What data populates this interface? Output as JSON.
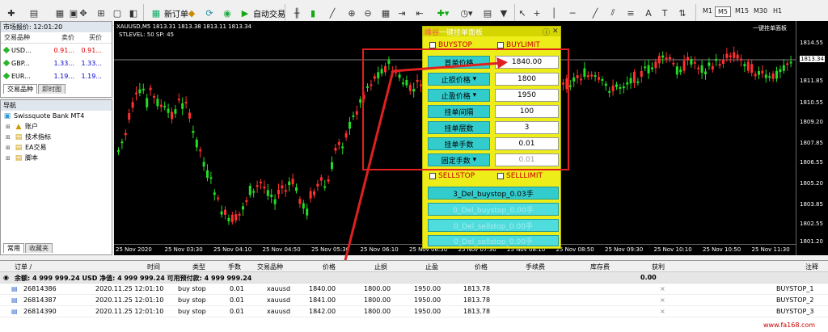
{
  "toolbar": {
    "new_order": "新订单",
    "auto_trading": "自动交易",
    "timeframes": [
      "M1",
      "M5",
      "M15",
      "M30",
      "H1"
    ],
    "active_timeframe": "M5"
  },
  "market_watch": {
    "title": "市场报价: 12:01:20",
    "columns": [
      "交易品种",
      "卖价",
      "买价"
    ],
    "rows": [
      {
        "symbol": "USD...",
        "bid": "0.91...",
        "ask": "0.91..."
      },
      {
        "symbol": "GBP...",
        "bid": "1.33...",
        "ask": "1.33..."
      },
      {
        "symbol": "EUR...",
        "bid": "1.19...",
        "ask": "1.19..."
      }
    ],
    "tabs": [
      "交易品种",
      "即时图"
    ]
  },
  "navigator": {
    "title": "导航",
    "root": "Swissquote Bank MT4",
    "items": [
      "账户",
      "技术指标",
      "EA交易",
      "脚本"
    ],
    "tabs": [
      "常用",
      "收藏夹"
    ]
  },
  "chart": {
    "info": "XAUUSD,M5  1813.31 1813.38 1813.11 1813.34",
    "info2": "STLEVEL:  50      SP:  45",
    "ea_label": "一键挂单面板",
    "price_labels": [
      "1814.55",
      "1813.34",
      "1811.85",
      "1810.55",
      "1809.20",
      "1807.85",
      "1806.55",
      "1805.20",
      "1803.85",
      "1802.55",
      "1801.20"
    ],
    "time_labels": [
      "25 Nov 2020",
      "25 Nov 03:30",
      "25 Nov 04:10",
      "25 Nov 04:50",
      "25 Nov 05:30",
      "25 Nov 06:10",
      "25 Nov 06:50",
      "25 Nov 07:30",
      "25 Nov 08:10",
      "25 Nov 08:50",
      "25 Nov 09:30",
      "25 Nov 10:10",
      "25 Nov 10:50",
      "25 Nov 11:30"
    ],
    "colors": {
      "bull": "#ff3030",
      "bear": "#22dd22",
      "bg": "#000000"
    }
  },
  "panel": {
    "title": "一键挂单面板",
    "logo": "峰谷",
    "buystop": "BUYSTOP",
    "buylimit": "BUYLIMIT",
    "sellstop": "SELLSTOP",
    "selllimit": "SELLLIMIT",
    "fields": [
      {
        "label": "首单价格",
        "value": "1840.00",
        "dropdown": false
      },
      {
        "label": "止损价格",
        "value": "1800",
        "dropdown": true
      },
      {
        "label": "止盈价格",
        "value": "1950",
        "dropdown": true
      },
      {
        "label": "挂单间隔",
        "value": "100",
        "dropdown": false
      },
      {
        "label": "挂单层数",
        "value": "3",
        "dropdown": false
      },
      {
        "label": "挂单手数",
        "value": "0.01",
        "dropdown": false
      },
      {
        "label": "固定手数",
        "value": "0.01",
        "dropdown": true
      }
    ],
    "delete_button": "3_Del_buystop_0.03手",
    "faded_buttons": [
      "0_Del_buystop_0.00手",
      "0_Del_sellstop_0.00手",
      "0_Del_sellstop_0.00手"
    ]
  },
  "orders": {
    "columns": [
      "订单 /",
      "时间",
      "类型",
      "手数",
      "交易品种",
      "价格",
      "止损",
      "止盈",
      "价格",
      "手续费",
      "库存费",
      "获利",
      "注释"
    ],
    "summary": "余额: 4 999 999.24 USD  净值: 4 999 999.24  可用预付款: 4 999 999.24",
    "summary_profit": "0.00",
    "rows": [
      {
        "id": "26814386",
        "time": "2020.11.25 12:01:10",
        "type": "buy stop",
        "lots": "0.01",
        "symbol": "xauusd",
        "price": "1840.00",
        "sl": "1800.00",
        "tp": "1950.00",
        "cur": "1813.78",
        "comment": "BUYSTOP_1"
      },
      {
        "id": "26814387",
        "time": "2020.11.25 12:01:10",
        "type": "buy stop",
        "lots": "0.01",
        "symbol": "xauusd",
        "price": "1841.00",
        "sl": "1800.00",
        "tp": "1950.00",
        "cur": "1813.78",
        "comment": "BUYSTOP_2"
      },
      {
        "id": "26814390",
        "time": "2020.11.25 12:01:10",
        "type": "buy stop",
        "lots": "0.01",
        "symbol": "xauusd",
        "price": "1842.00",
        "sl": "1800.00",
        "tp": "1950.00",
        "cur": "1813.78",
        "comment": "BUYSTOP_3"
      }
    ]
  },
  "watermark": "www.fa168.com"
}
